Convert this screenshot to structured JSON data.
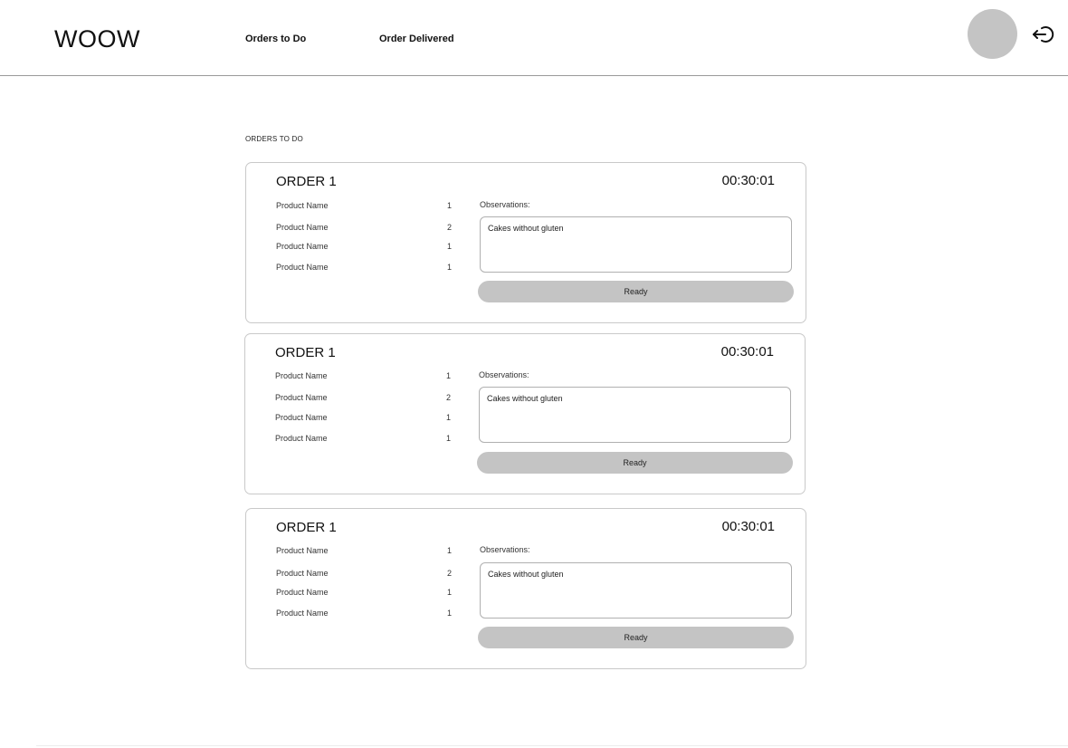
{
  "header": {
    "logo": "WOOW",
    "nav": [
      "Orders to Do",
      "Order Delivered"
    ]
  },
  "icons": {
    "avatar": "user-avatar",
    "logout": "logout-icon"
  },
  "section_title": "ORDERS TO DO",
  "orders": [
    {
      "title": "ORDER 1",
      "timer": "00:30:01",
      "products": [
        {
          "name": "Product Name",
          "qty": "1"
        },
        {
          "name": "Product Name",
          "qty": "2"
        },
        {
          "name": "Product Name",
          "qty": "1"
        },
        {
          "name": "Product Name",
          "qty": "1"
        }
      ],
      "observations_label": "Observations:",
      "observations": "Cakes without gluten",
      "button": "Ready"
    },
    {
      "title": "ORDER 1",
      "timer": "00:30:01",
      "products": [
        {
          "name": "Product Name",
          "qty": "1"
        },
        {
          "name": "Product Name",
          "qty": "2"
        },
        {
          "name": "Product Name",
          "qty": "1"
        },
        {
          "name": "Product Name",
          "qty": "1"
        }
      ],
      "observations_label": "Observations:",
      "observations": "Cakes without gluten",
      "button": "Ready"
    },
    {
      "title": "ORDER 1",
      "timer": "00:30:01",
      "products": [
        {
          "name": "Product Name",
          "qty": "1"
        },
        {
          "name": "Product Name",
          "qty": "2"
        },
        {
          "name": "Product Name",
          "qty": "1"
        },
        {
          "name": "Product Name",
          "qty": "1"
        }
      ],
      "observations_label": "Observations:",
      "observations": "Cakes without gluten",
      "button": "Ready"
    }
  ],
  "colors": {
    "avatar": "#c4c4c4",
    "button": "#c4c4c4",
    "card_border": "#c9c9c9"
  }
}
